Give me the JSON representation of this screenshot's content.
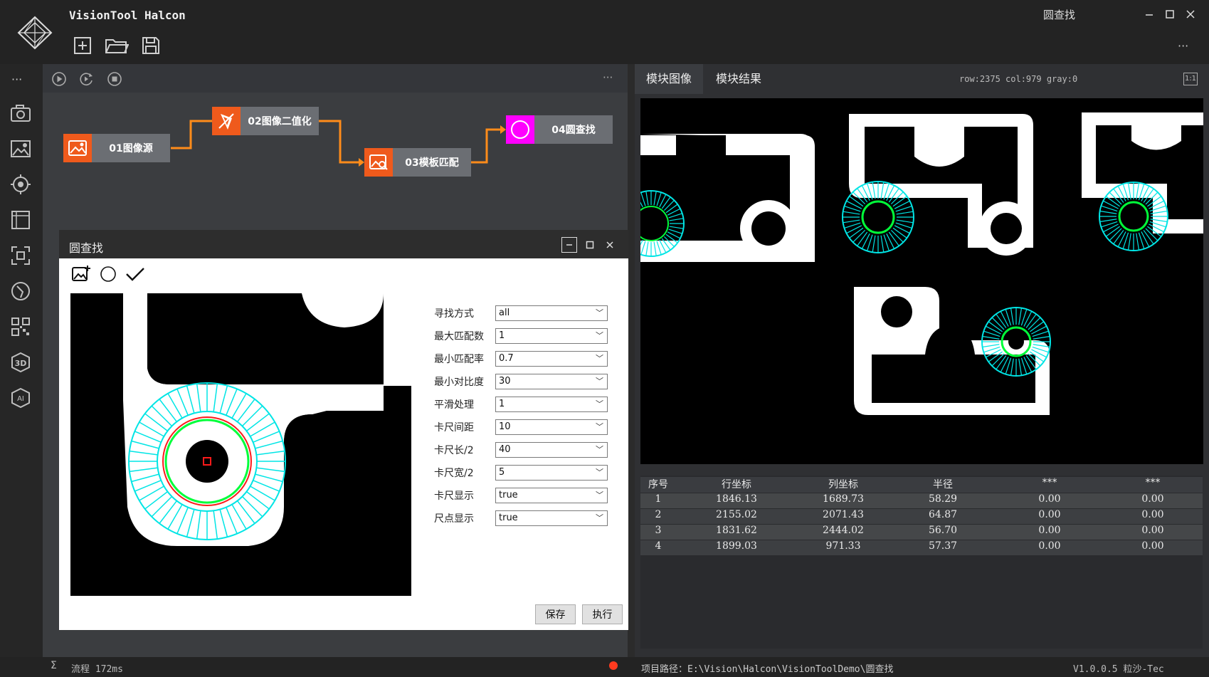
{
  "app": {
    "title": "VisionTool Halcon",
    "window_title": "圆查找",
    "more_label": "···"
  },
  "flow": {
    "nodes": [
      {
        "label": "01图像源"
      },
      {
        "label": "02图像二值化"
      },
      {
        "label": "03模板匹配"
      },
      {
        "label": "04圆查找"
      }
    ],
    "more_label": "···"
  },
  "dialog": {
    "title": "圆查找",
    "params": [
      {
        "label": "寻找方式",
        "value": "all"
      },
      {
        "label": "最大匹配数",
        "value": "1"
      },
      {
        "label": "最小匹配率",
        "value": "0.7"
      },
      {
        "label": "最小对比度",
        "value": "30"
      },
      {
        "label": "平滑处理",
        "value": "1"
      },
      {
        "label": "卡尺间距",
        "value": "10"
      },
      {
        "label": "卡尺长/2",
        "value": "40"
      },
      {
        "label": "卡尺宽/2",
        "value": "5"
      },
      {
        "label": "卡尺显示",
        "value": "true"
      },
      {
        "label": "尺点显示",
        "value": "true"
      }
    ],
    "save_label": "保存",
    "run_label": "执行"
  },
  "right": {
    "tabs": [
      {
        "label": "模块图像"
      },
      {
        "label": "模块结果"
      }
    ],
    "coords": "row:2375 col:979 gray:0",
    "zoom_label": "1:1"
  },
  "results": {
    "headers": [
      "序号",
      "行坐标",
      "列坐标",
      "半径",
      "***",
      "***"
    ],
    "rows": [
      [
        "1",
        "1846.13",
        "1689.73",
        "58.29",
        "0.00",
        "0.00"
      ],
      [
        "2",
        "2155.02",
        "2071.43",
        "64.87",
        "0.00",
        "0.00"
      ],
      [
        "3",
        "1831.62",
        "2444.02",
        "56.70",
        "0.00",
        "0.00"
      ],
      [
        "4",
        "1899.03",
        "971.33",
        "57.37",
        "0.00",
        "0.00"
      ]
    ]
  },
  "status": {
    "sigma": "Σ",
    "process_time": "流程 172ms",
    "project_path": "项目路径：E:\\Vision\\Halcon\\VisionToolDemo\\圆查找",
    "version": "V1.0.0.5 粒沙-Tec"
  },
  "colors": {
    "accent_orange": "#ef5a1c",
    "node_circle": "#ff00ff",
    "caliper": "#00e5e5",
    "circle_green": "#00ff3a",
    "point_red": "#ff1a1a",
    "status_dot": "#ff3b1f"
  }
}
